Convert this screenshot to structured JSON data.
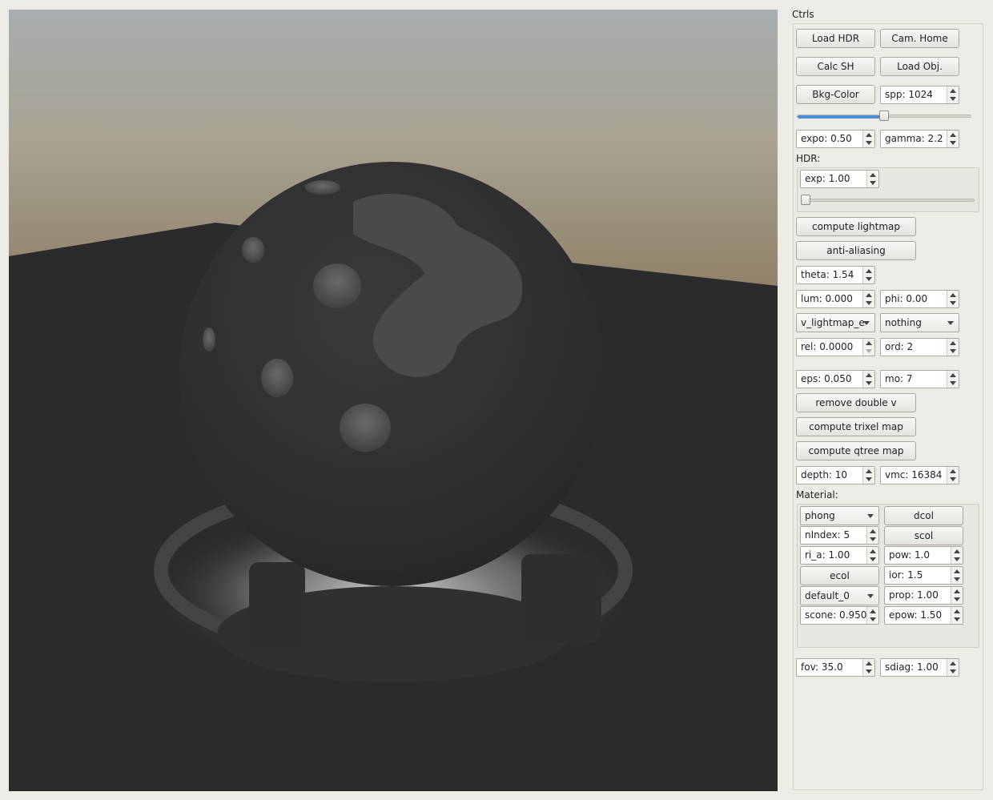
{
  "panel": {
    "title": "Ctrls",
    "buttons": {
      "load_hdr": "Load HDR",
      "cam_home": "Cam. Home",
      "calc_sh": "Calc SH",
      "load_obj": "Load Obj.",
      "bkg_color": "Bkg-Color",
      "compute_lightmap": "compute lightmap",
      "anti_aliasing": "anti-aliasing",
      "remove_double_v": "remove double v",
      "compute_trixel_map": "compute trixel map",
      "compute_qtree_map": "compute qtree map"
    },
    "spp": "spp: 1024",
    "spp_slider_value": 0.5,
    "expo": "expo: 0.50",
    "gamma": "gamma: 2.2",
    "hdr": {
      "label": "HDR:",
      "exp": "exp: 1.00",
      "exp_slider_value": 0.0
    },
    "theta": "theta: 1.54",
    "lum": "lum: 0.000",
    "phi": "phi: 0.00",
    "lightmap_mode": "v_lightmap_e",
    "secondary_mode": "nothing",
    "rel": "rel: 0.0000",
    "ord": "ord: 2",
    "eps": "eps: 0.050",
    "mo": "mo: 7",
    "depth": "depth: 10",
    "vmc": "vmc: 16384",
    "material": {
      "label": "Material:",
      "shader": "phong",
      "dcol": "dcol",
      "nindex": "nIndex: 5",
      "scol": "scol",
      "ri_a": "ri_a: 1.00",
      "pow": "pow: 1.0",
      "ecol": "ecol",
      "ior": "ior: 1.5",
      "preset": "default_0",
      "prop": "prop: 1.00",
      "scone": "scone: 0.950",
      "epow": "epow: 1.50"
    },
    "fov": "fov: 35.0",
    "sdiag": "sdiag: 1.00"
  },
  "colors": {
    "slider_accent": "#4a8fd2",
    "panel_bg": "#edebe6"
  }
}
